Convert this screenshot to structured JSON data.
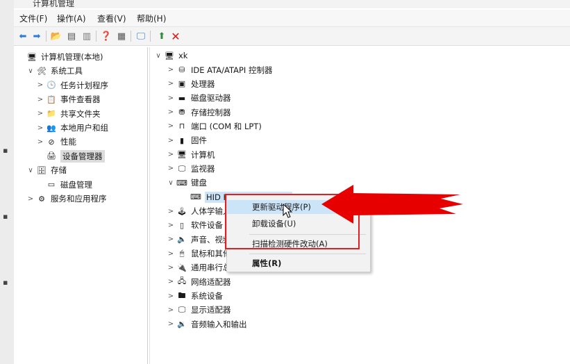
{
  "window": {
    "title": "计算机管理"
  },
  "menu": [
    "文件(F)",
    "操作(A)",
    "查看(V)",
    "帮助(H)"
  ],
  "left_tree": [
    {
      "label": "计算机管理(本地)",
      "arrow": "",
      "indent": 0,
      "icon": "computer-management-icon",
      "glyph": "🖥"
    },
    {
      "label": "系统工具",
      "arrow": "∨",
      "indent": 1,
      "icon": "tools-icon",
      "glyph": "🛠"
    },
    {
      "label": "任务计划程序",
      "arrow": ">",
      "indent": 2,
      "icon": "clock-icon",
      "glyph": "🕒"
    },
    {
      "label": "事件查看器",
      "arrow": ">",
      "indent": 2,
      "icon": "event-viewer-icon",
      "glyph": "📋"
    },
    {
      "label": "共享文件夹",
      "arrow": ">",
      "indent": 2,
      "icon": "shared-folder-icon",
      "glyph": "📁"
    },
    {
      "label": "本地用户和组",
      "arrow": ">",
      "indent": 2,
      "icon": "users-icon",
      "glyph": "👥"
    },
    {
      "label": "性能",
      "arrow": ">",
      "indent": 2,
      "icon": "performance-icon",
      "glyph": "⊘"
    },
    {
      "label": "设备管理器",
      "arrow": "",
      "indent": 2,
      "icon": "device-manager-icon",
      "glyph": "🖨",
      "selected": true
    },
    {
      "label": "存储",
      "arrow": "∨",
      "indent": 1,
      "icon": "storage-icon",
      "glyph": "🗄"
    },
    {
      "label": "磁盘管理",
      "arrow": "",
      "indent": 2,
      "icon": "disk-icon",
      "glyph": "▭"
    },
    {
      "label": "服务和应用程序",
      "arrow": ">",
      "indent": 1,
      "icon": "services-icon",
      "glyph": "⚙"
    }
  ],
  "device_tree": {
    "root": "xk",
    "items": [
      {
        "label": "IDE ATA/ATAPI 控制器",
        "arrow": ">",
        "icon": "ide-controller-icon",
        "glyph": "⛁"
      },
      {
        "label": "处理器",
        "arrow": ">",
        "icon": "processor-icon",
        "glyph": "▣"
      },
      {
        "label": "磁盘驱动器",
        "arrow": ">",
        "icon": "disk-drive-icon",
        "glyph": "▬"
      },
      {
        "label": "存储控制器",
        "arrow": ">",
        "icon": "storage-controller-icon",
        "glyph": "⛃"
      },
      {
        "label": "端口 (COM 和 LPT)",
        "arrow": ">",
        "icon": "port-icon",
        "glyph": "⊓"
      },
      {
        "label": "固件",
        "arrow": ">",
        "icon": "firmware-icon",
        "glyph": "▮"
      },
      {
        "label": "计算机",
        "arrow": ">",
        "icon": "computer-icon",
        "glyph": "🖥"
      },
      {
        "label": "监视器",
        "arrow": ">",
        "icon": "monitor-icon",
        "glyph": "🖵"
      },
      {
        "label": "键盘",
        "arrow": "∨",
        "icon": "keyboard-icon",
        "glyph": "⌨"
      },
      {
        "label": "HID Keyboard Device",
        "arrow": "",
        "icon": "keyboard-device-icon",
        "glyph": "⌨",
        "child": true,
        "selected": true
      },
      {
        "label": "人体学输入设备",
        "arrow": ">",
        "icon": "hid-icon",
        "glyph": "🕹"
      },
      {
        "label": "软件设备",
        "arrow": ">",
        "icon": "software-device-icon",
        "glyph": "▯"
      },
      {
        "label": "声音、视频和游戏控制器",
        "arrow": ">",
        "icon": "sound-icon",
        "glyph": "🔈"
      },
      {
        "label": "鼠标和其他指针设备",
        "arrow": ">",
        "icon": "mouse-icon",
        "glyph": "🖱"
      },
      {
        "label": "通用串行总线控制器",
        "arrow": ">",
        "icon": "usb-icon",
        "glyph": "🔌"
      },
      {
        "label": "网络适配器",
        "arrow": ">",
        "icon": "network-adapter-icon",
        "glyph": "🖧"
      },
      {
        "label": "系统设备",
        "arrow": ">",
        "icon": "system-device-icon",
        "glyph": "🖿"
      },
      {
        "label": "显示适配器",
        "arrow": ">",
        "icon": "display-adapter-icon",
        "glyph": "🖵"
      },
      {
        "label": "音频输入和输出",
        "arrow": ">",
        "icon": "audio-icon",
        "glyph": "🔉"
      }
    ]
  },
  "context_menu": {
    "update_driver": "更新驱动程序(P)",
    "uninstall": "卸载设备(U)",
    "scan": "扫描检测硬件改动(A)",
    "properties": "属性(R)"
  },
  "colors": {
    "highlight_box": "#e02020",
    "arrow": "#e60000",
    "selection": "#cce4f7"
  }
}
